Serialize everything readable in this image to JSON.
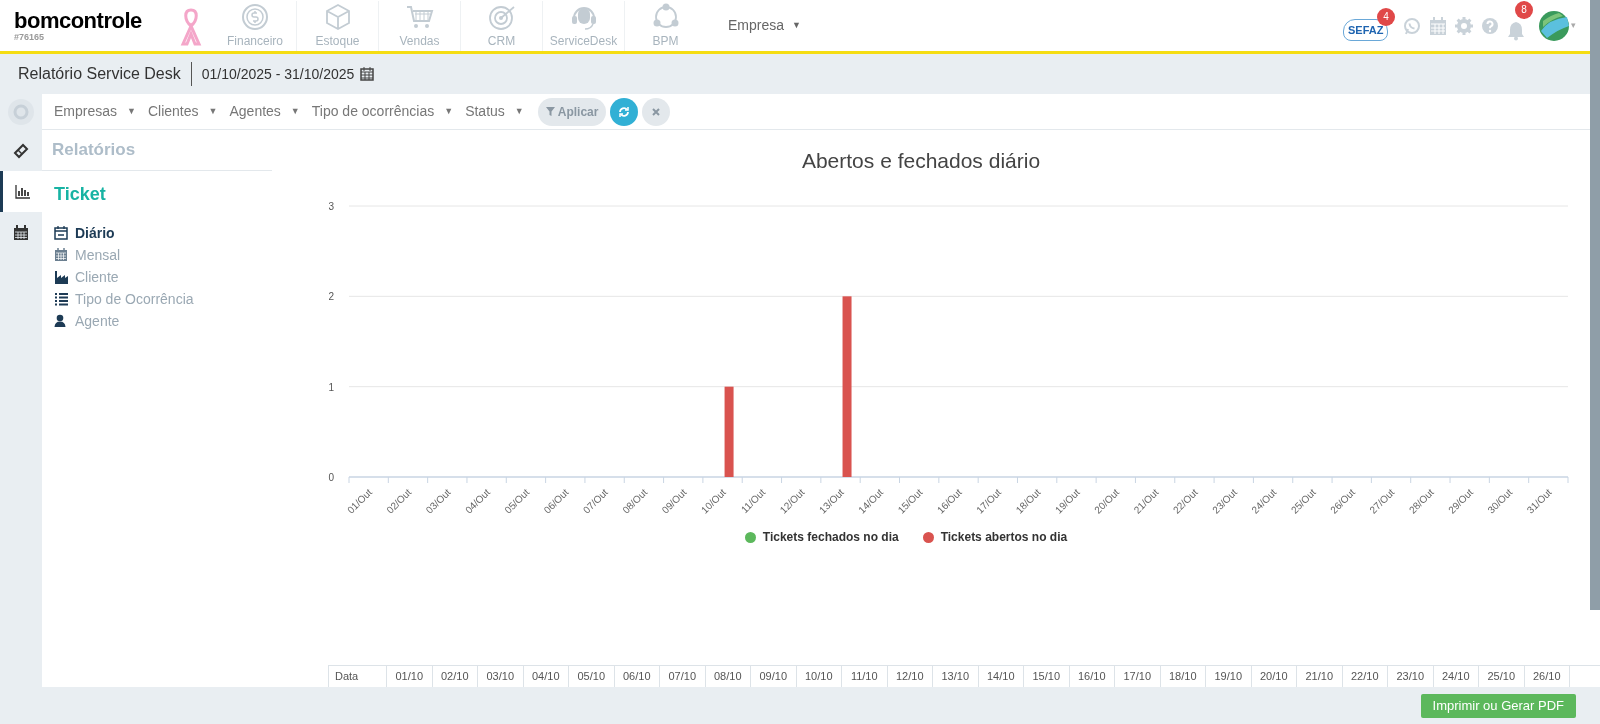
{
  "brand": {
    "logo": "bomcontrole",
    "account": "#76165"
  },
  "modules": [
    {
      "label": "Financeiro",
      "kind": "money"
    },
    {
      "label": "Estoque",
      "kind": "box"
    },
    {
      "label": "Vendas",
      "kind": "cart"
    },
    {
      "label": "CRM",
      "kind": "target"
    },
    {
      "label": "ServiceDesk",
      "kind": "headset"
    },
    {
      "label": "BPM",
      "kind": "process"
    }
  ],
  "company_menu": {
    "label": "Empresa",
    "caret": "▼"
  },
  "top_icons": {
    "sefaz": {
      "label": "SEFAZ",
      "badge": "4"
    },
    "notifications_badge": "8",
    "caret": "▾"
  },
  "page_header": {
    "title": "Relatório Service Desk",
    "date_range": "01/10/2025 - 31/10/2025"
  },
  "filters": [
    {
      "label": "Empresas",
      "caret": "▼"
    },
    {
      "label": "Clientes",
      "caret": "▼"
    },
    {
      "label": "Agentes",
      "caret": "▼"
    },
    {
      "label": "Tipo de ocorrências",
      "caret": "▼"
    },
    {
      "label": "Status",
      "caret": "▼"
    }
  ],
  "filter_actions": {
    "apply": "Aplicar"
  },
  "rail": [
    {
      "kind": "ticket",
      "selected": false
    },
    {
      "kind": "chart",
      "selected": true
    },
    {
      "kind": "calendar",
      "selected": false
    }
  ],
  "sidebar": {
    "heading": "Relatórios",
    "section": "Ticket",
    "items": [
      {
        "label": "Diário",
        "kind": "day",
        "selected": true
      },
      {
        "label": "Mensal",
        "kind": "month",
        "selected": false
      },
      {
        "label": "Cliente",
        "kind": "factory",
        "selected": false
      },
      {
        "label": "Tipo de Ocorrência",
        "kind": "list",
        "selected": false
      },
      {
        "label": "Agente",
        "kind": "user",
        "selected": false
      }
    ]
  },
  "chart": {
    "chart_data": {
      "type": "bar",
      "title": "Abertos e fechados diário",
      "categories": [
        "01/Out",
        "02/Out",
        "03/Out",
        "04/Out",
        "05/Out",
        "06/Out",
        "07/Out",
        "08/Out",
        "09/Out",
        "10/Out",
        "11/Out",
        "12/Out",
        "13/Out",
        "14/Out",
        "15/Out",
        "16/Out",
        "17/Out",
        "18/Out",
        "19/Out",
        "20/Out",
        "21/Out",
        "22/Out",
        "23/Out",
        "24/Out",
        "25/Out",
        "26/Out",
        "27/Out",
        "28/Out",
        "29/Out",
        "30/Out",
        "31/Out"
      ],
      "series": [
        {
          "name": "Tickets fechados no dia",
          "color": "#5cb85c",
          "values": [
            0,
            0,
            0,
            0,
            0,
            0,
            0,
            0,
            0,
            0,
            0,
            0,
            0,
            0,
            0,
            0,
            0,
            0,
            0,
            0,
            0,
            0,
            0,
            0,
            0,
            0,
            0,
            0,
            0,
            0,
            0
          ]
        },
        {
          "name": "Tickets abertos no dia",
          "color": "#d9534f",
          "values": [
            0,
            0,
            0,
            0,
            0,
            0,
            0,
            0,
            0,
            1,
            0,
            0,
            2,
            0,
            0,
            0,
            0,
            0,
            0,
            0,
            0,
            0,
            0,
            0,
            0,
            0,
            0,
            0,
            0,
            0,
            0
          ]
        }
      ],
      "ylim": [
        0,
        3
      ],
      "yticks": [
        0,
        1,
        2,
        3
      ]
    }
  },
  "table": {
    "columns": [
      "Data",
      "01/10",
      "02/10",
      "03/10",
      "04/10",
      "05/10",
      "06/10",
      "07/10",
      "08/10",
      "09/10",
      "10/10",
      "11/10",
      "12/10",
      "13/10",
      "14/10",
      "15/10",
      "16/10",
      "17/10",
      "18/10",
      "19/10",
      "20/10",
      "21/10",
      "22/10",
      "23/10",
      "24/10",
      "25/10",
      "26/10"
    ]
  },
  "footer": {
    "print_button": "Imprimir ou Gerar PDF"
  }
}
